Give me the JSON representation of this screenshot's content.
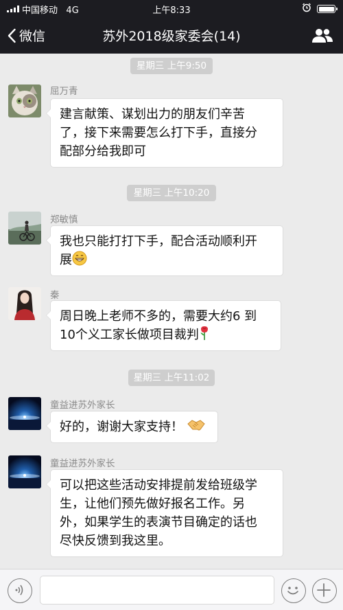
{
  "status_bar": {
    "carrier": "中国移动",
    "network": "4G",
    "time": "上午8:33"
  },
  "nav": {
    "back_label": "微信",
    "title": "苏外2018级家委会(14)"
  },
  "chat": {
    "time_labels": [
      "星期三 上午9:50",
      "星期三 上午10:20",
      "星期三 上午11:02"
    ],
    "messages": [
      {
        "sender": "屈万青",
        "text": "建言献策、谋划出力的朋友们辛苦\n了，接下来需要怎么打下手，直接分\n配部分给我即可"
      },
      {
        "sender": "郑敏慎",
        "text": "我也只能打打下手，配合活动顺利开\n展",
        "emoji": "grinning-emoji"
      },
      {
        "sender": "秦",
        "text": "周日晚上老师不多的，需要大约6 到\n10个义工家长做项目裁判",
        "emoji": "rose-emoji"
      },
      {
        "sender": "童益进苏外家长",
        "text": "好的，谢谢大家支持！",
        "emoji": "handshake-emoji"
      },
      {
        "sender": "童益进苏外家长",
        "text": "可以把这些活动安排提前发给班级学\n生，让他们预先做好报名工作。另\n外，如果学生的表演节目确定的话也\n尽快反馈到我这里。"
      }
    ]
  },
  "input_bar": {
    "voice_icon": "voice-icon",
    "emoji_icon": "smiley-icon",
    "add_icon": "plus-icon",
    "placeholder": ""
  },
  "colors": {
    "header_bg": "#1c1c21",
    "chat_bg": "#ebebeb",
    "time_pill_bg": "#cecece",
    "bubble_bg": "#ffffff"
  }
}
